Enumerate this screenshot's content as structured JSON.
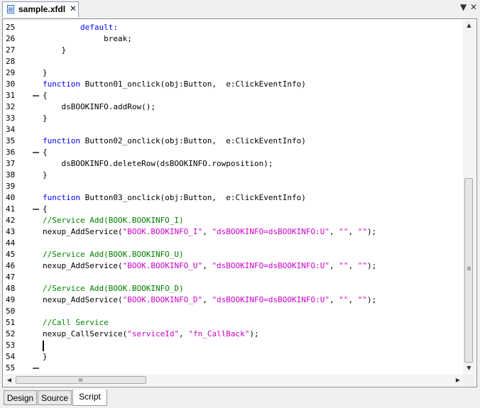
{
  "document_tab": {
    "title": "sample.xfdl",
    "close": "✕"
  },
  "window_controls": {
    "dropdown": "▼",
    "close": "✕"
  },
  "code_lines": [
    {
      "n": "25",
      "fold": false,
      "segs": [
        {
          "t": "        "
        },
        {
          "t": "default:",
          "c": "kw"
        }
      ]
    },
    {
      "n": "26",
      "fold": false,
      "segs": [
        {
          "t": "             break;"
        }
      ]
    },
    {
      "n": "27",
      "fold": false,
      "segs": [
        {
          "t": "    }"
        }
      ]
    },
    {
      "n": "28",
      "fold": false,
      "segs": []
    },
    {
      "n": "29",
      "fold": false,
      "segs": [
        {
          "t": "}"
        }
      ]
    },
    {
      "n": "30",
      "fold": false,
      "segs": [
        {
          "t": "function",
          "c": "kw"
        },
        {
          "t": " Button01_onclick(obj:Button,  e:ClickEventInfo)"
        }
      ]
    },
    {
      "n": "31",
      "fold": true,
      "segs": [
        {
          "t": "{"
        }
      ]
    },
    {
      "n": "32",
      "fold": false,
      "segs": [
        {
          "t": "    dsBOOKINFO.addRow();"
        }
      ]
    },
    {
      "n": "33",
      "fold": false,
      "segs": [
        {
          "t": "}"
        }
      ]
    },
    {
      "n": "34",
      "fold": false,
      "segs": []
    },
    {
      "n": "35",
      "fold": false,
      "segs": [
        {
          "t": "function",
          "c": "kw"
        },
        {
          "t": " Button02_onclick(obj:Button,  e:ClickEventInfo)"
        }
      ]
    },
    {
      "n": "36",
      "fold": true,
      "segs": [
        {
          "t": "{"
        }
      ]
    },
    {
      "n": "37",
      "fold": false,
      "segs": [
        {
          "t": "    dsBOOKINFO.deleteRow(dsBOOKINFO.rowposition);"
        }
      ]
    },
    {
      "n": "38",
      "fold": false,
      "segs": [
        {
          "t": "}"
        }
      ]
    },
    {
      "n": "39",
      "fold": false,
      "segs": []
    },
    {
      "n": "40",
      "fold": false,
      "segs": [
        {
          "t": "function",
          "c": "kw"
        },
        {
          "t": " Button03_onclick(obj:Button,  e:ClickEventInfo)"
        }
      ]
    },
    {
      "n": "41",
      "fold": true,
      "segs": [
        {
          "t": "{"
        }
      ]
    },
    {
      "n": "42",
      "fold": false,
      "segs": [
        {
          "t": "//Service Add(BOOK.BOOKINFO_I)",
          "c": "cm"
        }
      ]
    },
    {
      "n": "43",
      "fold": false,
      "segs": [
        {
          "t": "nexup_AddService("
        },
        {
          "t": "\"BOOK.BOOKINFO_I\"",
          "c": "str"
        },
        {
          "t": ", "
        },
        {
          "t": "\"dsBOOKINFO=dsBOOKINFO:U\"",
          "c": "str"
        },
        {
          "t": ", "
        },
        {
          "t": "\"\"",
          "c": "str"
        },
        {
          "t": ", "
        },
        {
          "t": "\"\"",
          "c": "str"
        },
        {
          "t": ");"
        }
      ]
    },
    {
      "n": "44",
      "fold": false,
      "segs": []
    },
    {
      "n": "45",
      "fold": false,
      "segs": [
        {
          "t": "//Service Add(BOOK.BOOKINFO_U)",
          "c": "cm"
        }
      ]
    },
    {
      "n": "46",
      "fold": false,
      "segs": [
        {
          "t": "nexup_AddService("
        },
        {
          "t": "\"BOOK.BOOKINFO_U\"",
          "c": "str"
        },
        {
          "t": ", "
        },
        {
          "t": "\"dsBOOKINFO=dsBOOKINFO:U\"",
          "c": "str"
        },
        {
          "t": ", "
        },
        {
          "t": "\"\"",
          "c": "str"
        },
        {
          "t": ", "
        },
        {
          "t": "\"\"",
          "c": "str"
        },
        {
          "t": ");"
        }
      ]
    },
    {
      "n": "47",
      "fold": false,
      "segs": []
    },
    {
      "n": "48",
      "fold": false,
      "segs": [
        {
          "t": "//Service Add(BOOK.BOOKINFO_D)",
          "c": "cm"
        }
      ]
    },
    {
      "n": "49",
      "fold": false,
      "segs": [
        {
          "t": "nexup_AddService("
        },
        {
          "t": "\"BOOK.BOOKINFO_D\"",
          "c": "str"
        },
        {
          "t": ", "
        },
        {
          "t": "\"dsBOOKINFO=dsBOOKINFO:U\"",
          "c": "str"
        },
        {
          "t": ", "
        },
        {
          "t": "\"\"",
          "c": "str"
        },
        {
          "t": ", "
        },
        {
          "t": "\"\"",
          "c": "str"
        },
        {
          "t": ");"
        }
      ]
    },
    {
      "n": "50",
      "fold": false,
      "segs": []
    },
    {
      "n": "51",
      "fold": false,
      "segs": [
        {
          "t": "//Call Service",
          "c": "cm"
        }
      ]
    },
    {
      "n": "52",
      "fold": false,
      "segs": [
        {
          "t": "nexup_CallService("
        },
        {
          "t": "\"serviceId\"",
          "c": "str"
        },
        {
          "t": ", "
        },
        {
          "t": "\"fn_CallBack\"",
          "c": "str"
        },
        {
          "t": ");"
        }
      ]
    },
    {
      "n": "53",
      "fold": false,
      "segs": [],
      "caret": true
    },
    {
      "n": "54",
      "fold": false,
      "segs": [
        {
          "t": "}"
        }
      ]
    },
    {
      "n": "55",
      "fold": true,
      "segs": []
    }
  ],
  "bottom_tabs": [
    {
      "label": "Design",
      "active": false
    },
    {
      "label": "Source",
      "active": false
    },
    {
      "label": "Script",
      "active": true
    }
  ],
  "colors": {
    "keyword": "#0000ff",
    "comment": "#008000",
    "string": "#cc00cc"
  }
}
